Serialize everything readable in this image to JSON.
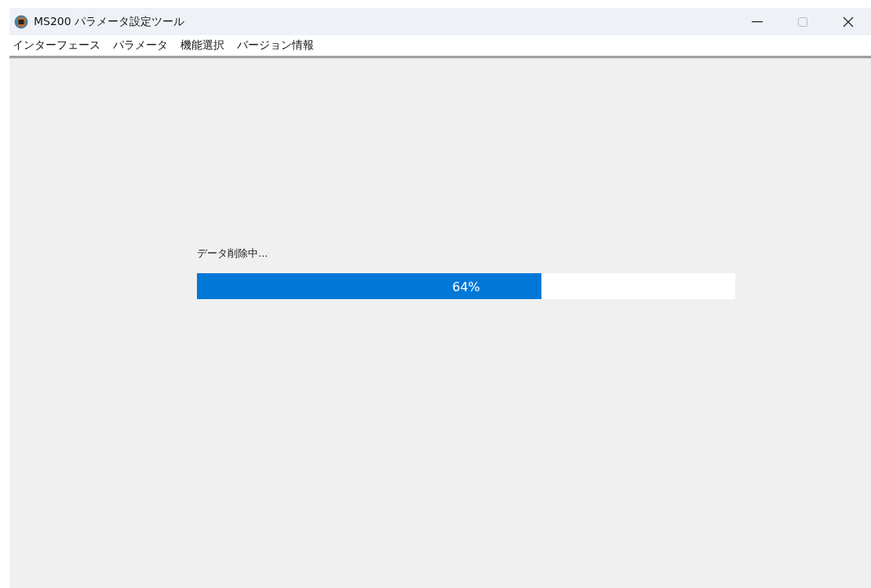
{
  "window": {
    "title": "MS200 パラメータ設定ツール"
  },
  "menu": [
    {
      "label": "インターフェース"
    },
    {
      "label": "パラメータ"
    },
    {
      "label": "機能選択"
    },
    {
      "label": "バージョン情報"
    }
  ],
  "progress": {
    "message": "データ削除中...",
    "level": 0.64,
    "reading": "64%"
  }
}
